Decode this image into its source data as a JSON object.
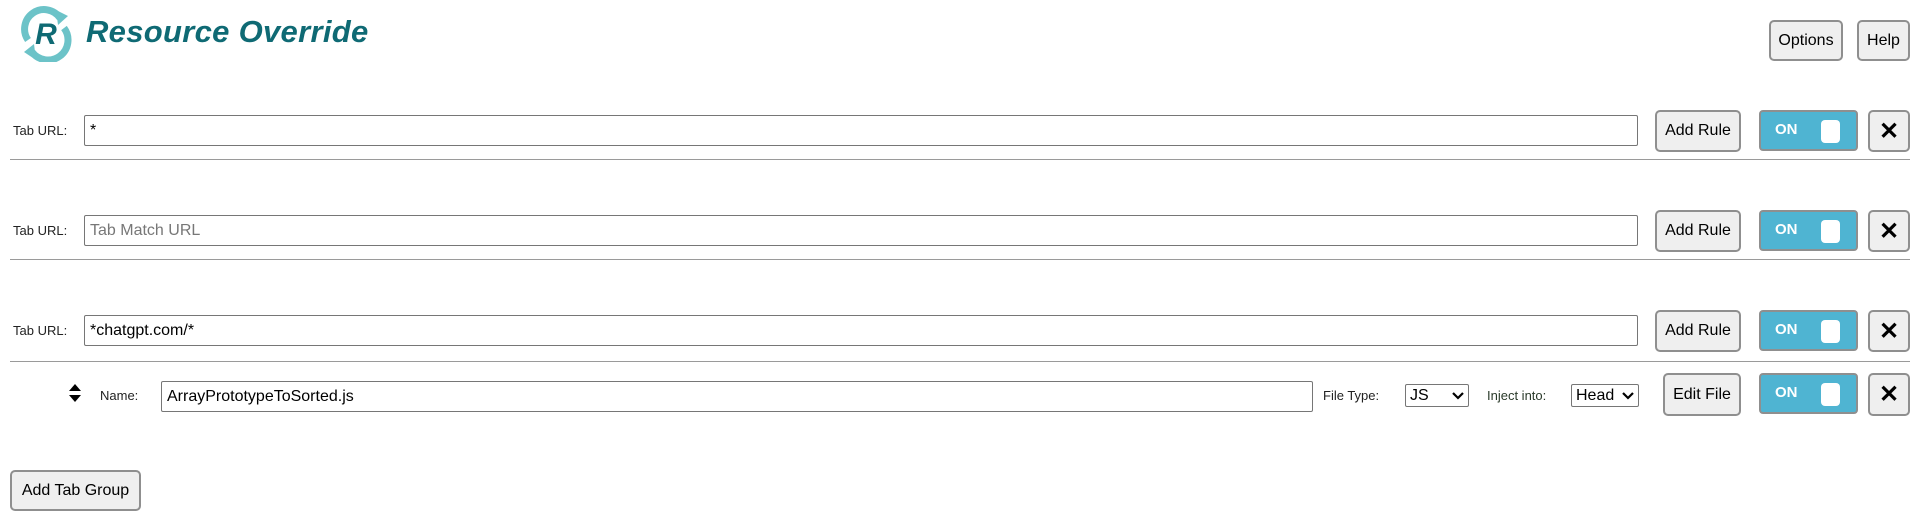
{
  "header": {
    "title": "Resource Override",
    "logo_letter": "R",
    "options_label": "Options",
    "help_label": "Help"
  },
  "colors": {
    "brand": "#0f6a74",
    "logo_ring": "#6cc3c8",
    "toggle_on": "#4fb4d2"
  },
  "tab_groups": [
    {
      "label": "Tab URL:",
      "value": "*",
      "placeholder": "Tab Match URL",
      "add_rule_label": "Add Rule",
      "toggle_label": "ON",
      "toggle_on": true,
      "close_icon": "x-icon"
    },
    {
      "label": "Tab URL:",
      "value": "",
      "placeholder": "Tab Match URL",
      "add_rule_label": "Add Rule",
      "toggle_label": "ON",
      "toggle_on": true,
      "close_icon": "x-icon"
    },
    {
      "label": "Tab URL:",
      "value": "*chatgpt.com/*",
      "placeholder": "Tab Match URL",
      "add_rule_label": "Add Rule",
      "toggle_label": "ON",
      "toggle_on": true,
      "close_icon": "x-icon",
      "rules": [
        {
          "name_label": "Name:",
          "name_value": "ArrayPrototypeToSorted.js",
          "file_type_label": "File Type:",
          "file_type_value": "JS",
          "inject_label": "Inject into:",
          "inject_value": "Head",
          "edit_label": "Edit File",
          "toggle_label": "ON",
          "toggle_on": true
        }
      ]
    }
  ],
  "add_tab_group_label": "Add Tab Group"
}
